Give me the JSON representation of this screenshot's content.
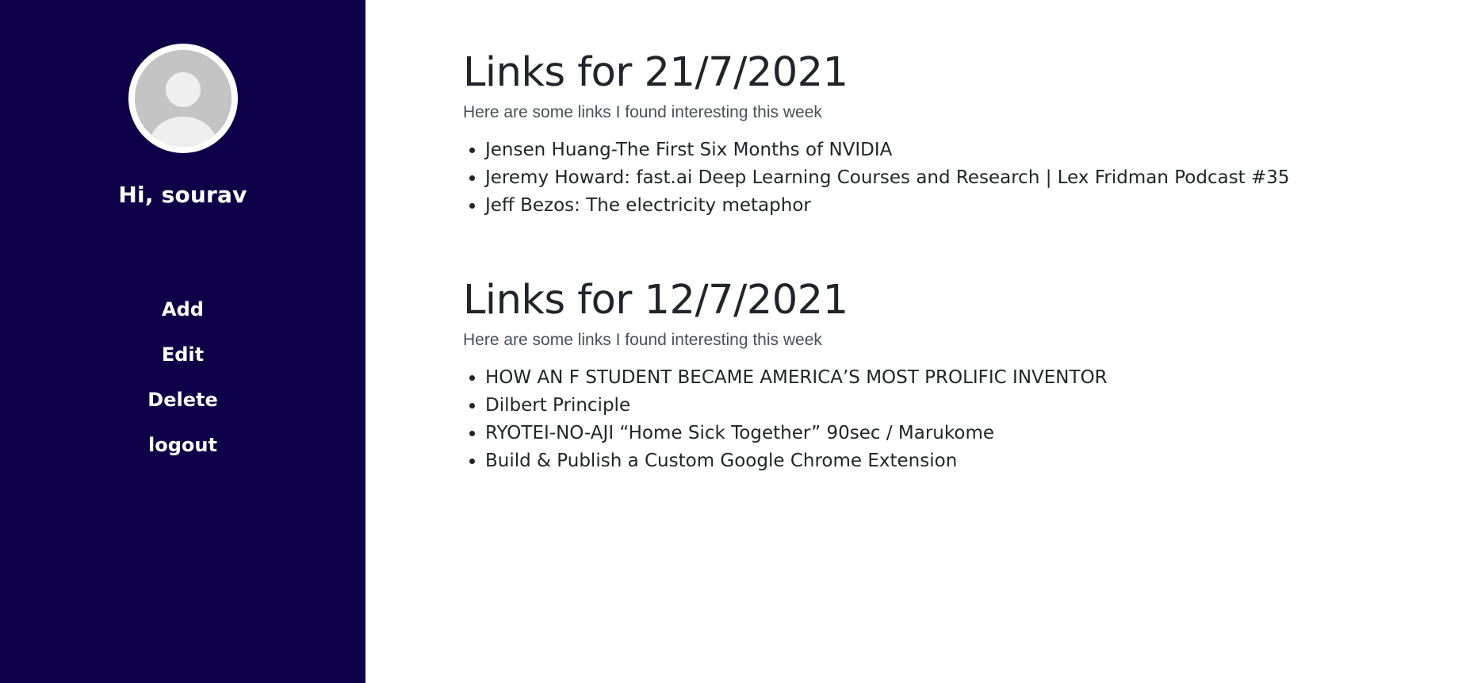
{
  "sidebar": {
    "greeting": "Hi, sourav",
    "avatar_icon": "user-avatar-icon",
    "nav_items": [
      {
        "label": "Add"
      },
      {
        "label": "Edit"
      },
      {
        "label": "Delete"
      },
      {
        "label": "logout"
      }
    ],
    "colors": {
      "background": "#0e0048",
      "text": "#ffffff"
    }
  },
  "main": {
    "sections": [
      {
        "title": "Links for 21/7/2021",
        "subtitle": "Here are some links I found interesting this week",
        "links": [
          "Jensen Huang-The First Six Months of NVIDIA",
          "Jeremy Howard: fast.ai Deep Learning Courses and Research | Lex Fridman Podcast #35",
          "Jeff Bezos: The electricity metaphor"
        ]
      },
      {
        "title": "Links for 12/7/2021",
        "subtitle": "Here are some links I found interesting this week",
        "links": [
          "HOW AN F STUDENT BECAME AMERICA’S MOST PROLIFIC INVENTOR",
          "Dilbert Principle",
          "RYOTEI-NO-AJI “Home Sick Together” 90sec / Marukome",
          "Build & Publish a Custom Google Chrome Extension"
        ]
      }
    ]
  }
}
